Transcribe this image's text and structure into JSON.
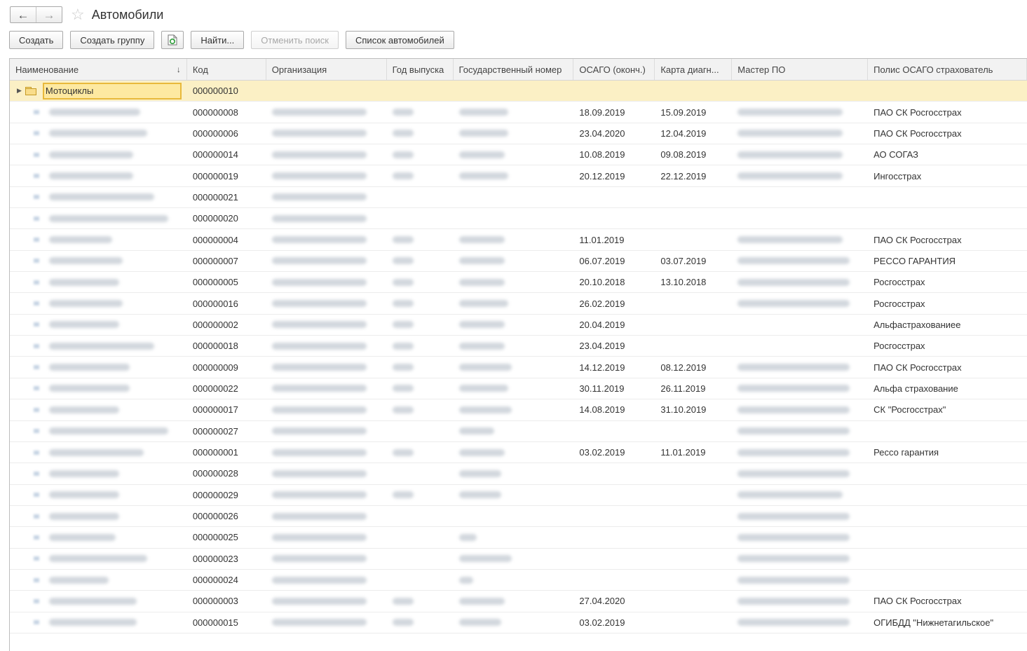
{
  "window": {
    "title": "Автомобили"
  },
  "toolbar": {
    "create": "Создать",
    "create_group": "Создать группу",
    "find": "Найти...",
    "cancel_search": "Отменить поиск",
    "car_list": "Список автомобилей"
  },
  "table": {
    "columns": [
      "Наименование",
      "Код",
      "Организация",
      "Год выпуска",
      "Государственный номер",
      "ОСАГО (оконч.)",
      "Карта диагн...",
      "Мастер ПО",
      "Полис ОСАГО страхователь"
    ],
    "group_row": {
      "name": "Мотоциклы",
      "code": "000000010"
    },
    "rows": [
      {
        "code": "000000008",
        "osago": "18.09.2019",
        "diag": "15.09.2019",
        "policy": "ПАО СК Росгосстрах"
      },
      {
        "code": "000000006",
        "osago": "23.04.2020",
        "diag": "12.04.2019",
        "policy": "ПАО СК Росгосстрах"
      },
      {
        "code": "000000014",
        "osago": "10.08.2019",
        "diag": "09.08.2019",
        "policy": "АО СОГАЗ"
      },
      {
        "code": "000000019",
        "osago": "20.12.2019",
        "diag": "22.12.2019",
        "policy": "Ингосстрах"
      },
      {
        "code": "000000021",
        "osago": "",
        "diag": "",
        "policy": ""
      },
      {
        "code": "000000020",
        "osago": "",
        "diag": "",
        "policy": ""
      },
      {
        "code": "000000004",
        "osago": "11.01.2019",
        "diag": "",
        "policy": "ПАО СК Росгосстрах"
      },
      {
        "code": "000000007",
        "osago": "06.07.2019",
        "diag": "03.07.2019",
        "policy": "РЕССО ГАРАНТИЯ"
      },
      {
        "code": "000000005",
        "osago": "20.10.2018",
        "diag": "13.10.2018",
        "policy": "Росгосстрах"
      },
      {
        "code": "000000016",
        "osago": "26.02.2019",
        "diag": "",
        "policy": "Росгосстрах"
      },
      {
        "code": "000000002",
        "osago": "20.04.2019",
        "diag": "",
        "policy": "Альфастрахованиее"
      },
      {
        "code": "000000018",
        "osago": "23.04.2019",
        "diag": "",
        "policy": "Росгосстрах"
      },
      {
        "code": "000000009",
        "osago": "14.12.2019",
        "diag": "08.12.2019",
        "policy": "ПАО СК Росгосстрах"
      },
      {
        "code": "000000022",
        "osago": "30.11.2019",
        "diag": "26.11.2019",
        "policy": "Альфа страхование"
      },
      {
        "code": "000000017",
        "osago": "14.08.2019",
        "diag": "31.10.2019",
        "policy": "СК \"Росгосстрах\""
      },
      {
        "code": "000000027",
        "osago": "",
        "diag": "",
        "policy": ""
      },
      {
        "code": "000000001",
        "osago": "03.02.2019",
        "diag": "11.01.2019",
        "policy": "Рессо гарантия"
      },
      {
        "code": "000000028",
        "osago": "",
        "diag": "",
        "policy": ""
      },
      {
        "code": "000000029",
        "osago": "",
        "diag": "",
        "policy": ""
      },
      {
        "code": "000000026",
        "osago": "",
        "diag": "",
        "policy": ""
      },
      {
        "code": "000000025",
        "osago": "",
        "diag": "",
        "policy": ""
      },
      {
        "code": "000000023",
        "osago": "",
        "diag": "",
        "policy": ""
      },
      {
        "code": "000000024",
        "osago": "",
        "diag": "",
        "policy": ""
      },
      {
        "code": "000000003",
        "osago": "27.04.2020",
        "diag": "",
        "policy": "ПАО СК Росгосстрах"
      },
      {
        "code": "000000015",
        "osago": "03.02.2019",
        "diag": "",
        "policy": "ОГИБДД \"Нижнетагильское\""
      }
    ]
  },
  "colors": {
    "group_row_bg": "#fbf0c5",
    "selection_border": "#e8b93b",
    "header_bg": "#f2f2f2"
  },
  "icons": {
    "back": "arrow-left-icon",
    "forward": "arrow-right-icon",
    "favorite": "star-icon",
    "folder": "folder-icon",
    "refresh": "refresh-doc-icon",
    "sort": "sort-down-icon"
  }
}
